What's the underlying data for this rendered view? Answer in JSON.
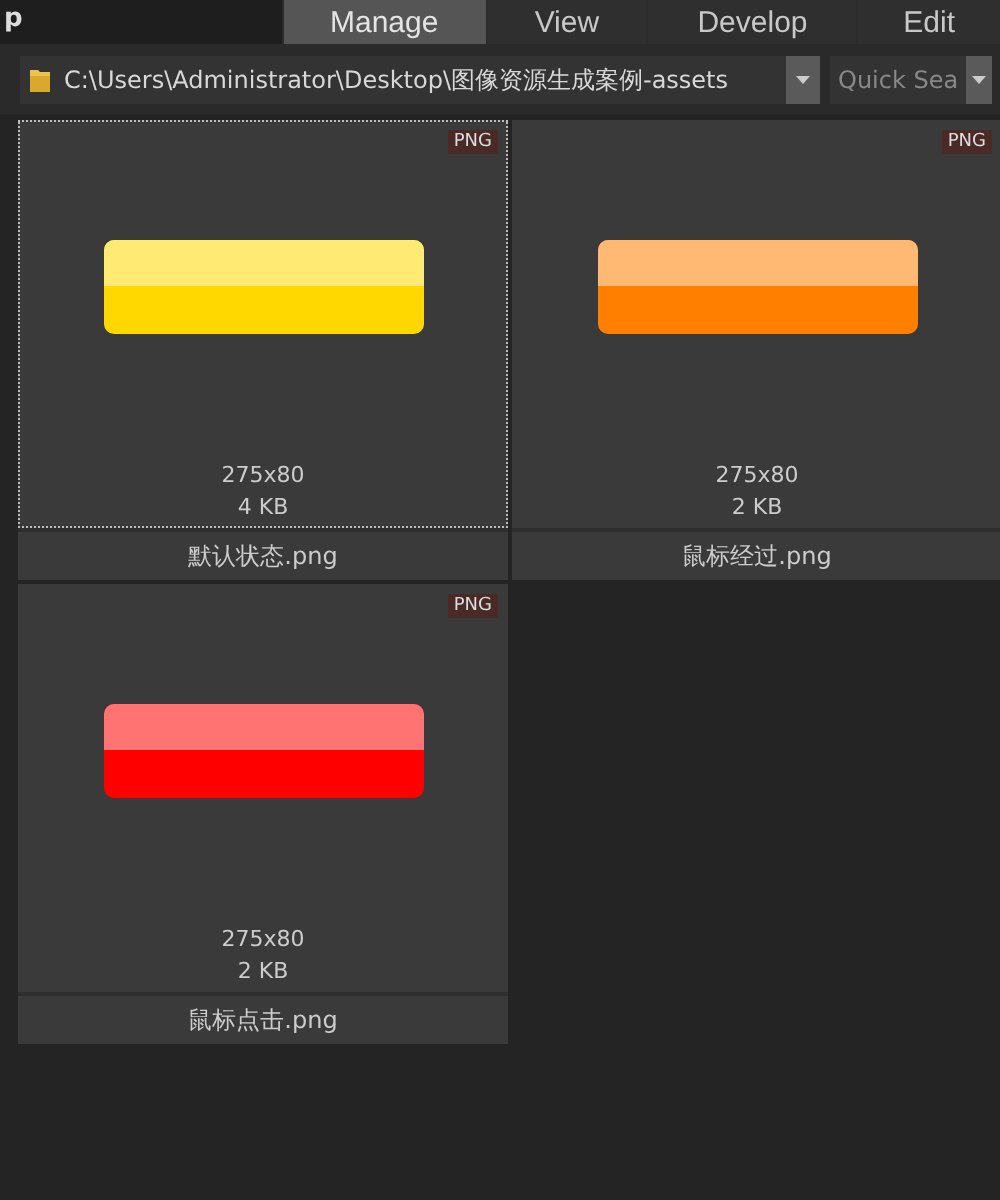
{
  "app_title": "p",
  "tabs": [
    {
      "label": "Manage",
      "selected": true
    },
    {
      "label": "View",
      "selected": false
    },
    {
      "label": "Develop",
      "selected": false
    },
    {
      "label": "Edit",
      "selected": false
    }
  ],
  "path_field": {
    "value": "C:\\Users\\Administrator\\Desktop\\图像资源生成案例-assets"
  },
  "search": {
    "placeholder": "Quick Sea"
  },
  "files": [
    {
      "badge": "PNG",
      "dimensions": "275x80",
      "size": "4 KB",
      "name": "默认状态.png",
      "color": "#ffd800",
      "selected": true
    },
    {
      "badge": "PNG",
      "dimensions": "275x80",
      "size": "2 KB",
      "name": "鼠标经过.png",
      "color": "#ff7f00",
      "selected": false
    },
    {
      "badge": "PNG",
      "dimensions": "275x80",
      "size": "2 KB",
      "name": "鼠标点击.png",
      "color": "#ff0000",
      "selected": false
    }
  ]
}
